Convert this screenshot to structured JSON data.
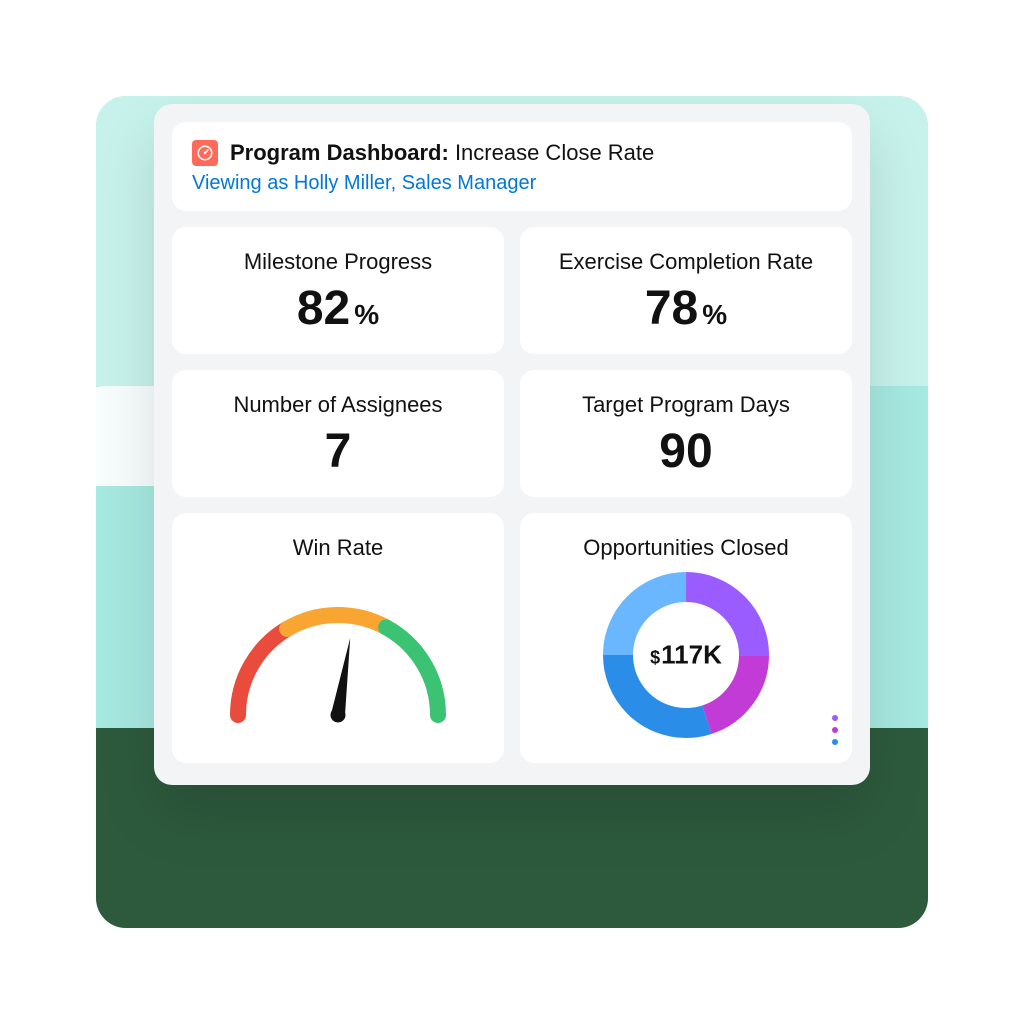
{
  "header": {
    "title_prefix": "Program Dashboard:",
    "title_rest": " Increase Close Rate",
    "viewing_as": "Viewing as Holly Miller, Sales Manager",
    "icon": "gauge-icon"
  },
  "tiles": {
    "milestone": {
      "label": "Milestone Progress",
      "value": "82",
      "unit": "%"
    },
    "exercise": {
      "label": "Exercise Completion Rate",
      "value": "78",
      "unit": "%"
    },
    "assignees": {
      "label": "Number of Assignees",
      "value": "7"
    },
    "target_days": {
      "label": "Target Program Days",
      "value": "90"
    },
    "win_rate": {
      "label": "Win Rate"
    },
    "opps_closed": {
      "label": "Opportunities Closed",
      "currency": "$",
      "value": "117K"
    }
  },
  "chart_data": [
    {
      "type": "gauge",
      "title": "Win Rate",
      "range": [
        0,
        100
      ],
      "value": 55,
      "segments": [
        {
          "name": "red",
          "from": 0,
          "to": 33,
          "color": "#e94b3c"
        },
        {
          "name": "orange",
          "from": 33,
          "to": 66,
          "color": "#f8a531"
        },
        {
          "name": "green",
          "from": 66,
          "to": 100,
          "color": "#3bc273"
        }
      ]
    },
    {
      "type": "donut",
      "title": "Opportunities Closed",
      "center_label": "$117K",
      "series": [
        {
          "name": "slice-a",
          "value": 25,
          "color": "#6bb7ff"
        },
        {
          "name": "slice-b",
          "value": 25,
          "color": "#9b5cff"
        },
        {
          "name": "slice-c",
          "value": 20,
          "color": "#c23bd6"
        },
        {
          "name": "slice-d",
          "value": 30,
          "color": "#2a8de8"
        }
      ],
      "legend_dots": [
        "#9b5cff",
        "#c23bd6",
        "#2a8de8"
      ]
    }
  ]
}
